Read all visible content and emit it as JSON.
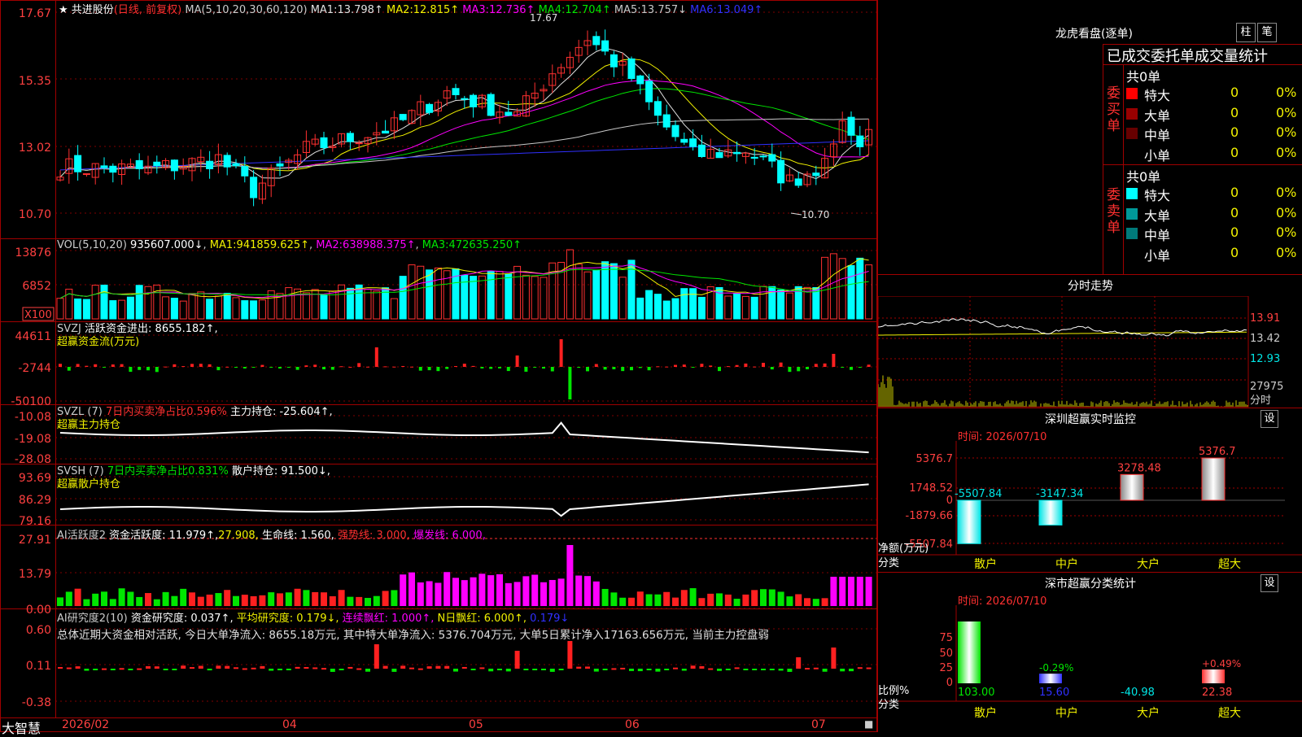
{
  "stock": {
    "name": "共进股份",
    "mode": "(日线, 前复权)",
    "ma_header": "MA(5,10,20,30,60,120)",
    "ma": [
      {
        "label": "MA1:",
        "value": "13.798↑",
        "color": "#e0e0e0"
      },
      {
        "label": "MA2:",
        "value": "12.815↑",
        "color": "#f2f200"
      },
      {
        "label": "MA3:",
        "value": "12.736↑",
        "color": "#ff00ff"
      },
      {
        "label": "MA4:",
        "value": "12.704↑",
        "color": "#00e600"
      },
      {
        "label": "MA5:",
        "value": "13.757↓",
        "color": "#c8c8c8"
      },
      {
        "label": "MA6:",
        "value": "13.049↑",
        "color": "#3030ff"
      }
    ],
    "y_ticks": [
      "17.67",
      "15.35",
      "13.02",
      "10.70"
    ],
    "high_label": "17.67",
    "low_label": "10.70"
  },
  "vol": {
    "header": "VOL(5,10,20)",
    "value": "935607.000↓",
    "ma": [
      {
        "label": "MA1:",
        "value": "941859.625↑",
        "color": "#f2f200"
      },
      {
        "label": "MA2:",
        "value": "638988.375↑",
        "color": "#ff00ff"
      },
      {
        "label": "MA3:",
        "value": "472635.250↑",
        "color": "#00e600"
      }
    ],
    "y_ticks": [
      "13876",
      "6852",
      "X100"
    ]
  },
  "svzj": {
    "header": "SVZJ",
    "text": "活跃资金进出: 8655.182↑,",
    "subtitle": "超赢资金流(万元)",
    "y_ticks": [
      "44611",
      "-2744",
      "-50100"
    ]
  },
  "svzl": {
    "header": "SVZL (7)",
    "ratio": "7日内买卖净占比0.596%",
    "hold": "主力持仓: -25.604↑,",
    "subtitle": "超赢主力持仓",
    "y_ticks": [
      "-10.08",
      "-19.08",
      "-28.08"
    ]
  },
  "svsh": {
    "header": "SVSH (7)",
    "ratio": "7日内买卖净占比0.831%",
    "hold": "散户持仓: 91.500↓,",
    "subtitle": "超赢散户持仓",
    "y_ticks": [
      "93.69",
      "86.29",
      "79.16"
    ]
  },
  "ai_active": {
    "header": "AI活跃度2",
    "a": "资金活跃度: 11.979↑,",
    "b": "27.908,",
    "c": "生命线: 1.560,",
    "d": "强势线: 3.000,",
    "e": "爆发线: 6.000,",
    "y_ticks": [
      "27.91",
      "13.79",
      "0.00"
    ]
  },
  "ai_research": {
    "header": "AI研究度2(10)",
    "a": "资金研究度: 0.037↑,",
    "b": "平均研究度: 0.179↓,",
    "c": "连续飘红: 1.000↑,",
    "d": "N日飘红: 6.000↑,",
    "e": "0.179↓",
    "summary": "总体近期大资金相对活跃, 今日大单净流入: 8655.18万元, 其中特大单净流入: 5376.704万元, 大单5日累计净入17163.656万元, 当前主力控盘弱",
    "y_ticks": [
      "0.60",
      "0.11",
      "-0.38"
    ]
  },
  "xaxis": {
    "labels": [
      "2026/02",
      "04",
      "05",
      "06",
      "07"
    ]
  },
  "brand": "大智慧",
  "longhu": {
    "title": "龙虎看盘(逐单)",
    "btn1": "柱",
    "btn2": "笔",
    "stat_title": "已成交委托单成交量统计",
    "buy_label": "委买单",
    "sell_label": "委卖单",
    "total": "共0单",
    "buy_rows": [
      {
        "name": "特大",
        "count": "0",
        "pct": "0%",
        "color": "#ff0000"
      },
      {
        "name": "大单",
        "count": "0",
        "pct": "0%",
        "color": "#990000"
      },
      {
        "name": "中单",
        "count": "0",
        "pct": "0%",
        "color": "#660000"
      },
      {
        "name": "小单",
        "count": "0",
        "pct": "0%",
        "color": ""
      }
    ],
    "sell_rows": [
      {
        "name": "特大",
        "count": "0",
        "pct": "0%",
        "color": "#00ffff"
      },
      {
        "name": "大单",
        "count": "0",
        "pct": "0%",
        "color": "#009999"
      },
      {
        "name": "中单",
        "count": "0",
        "pct": "0%",
        "color": "#007a7a"
      },
      {
        "name": "小单",
        "count": "0",
        "pct": "0%",
        "color": ""
      }
    ]
  },
  "fenshi": {
    "title": "分时走势",
    "y_ticks": [
      "13.91",
      "13.42",
      "12.93",
      "27975"
    ],
    "vol_label": "分时"
  },
  "sz_monitor": {
    "title": "深圳超赢实时监控",
    "btn": "设",
    "time": "时间: 2026/07/10",
    "y_ticks": [
      "5376.7",
      "1748.52",
      "0",
      "-1879.66",
      "-5507.84"
    ],
    "unit_label": "净额(万元)",
    "cat_label": "分类",
    "categories": [
      "散户",
      "中户",
      "大户",
      "超大"
    ],
    "values": [
      -5507.84,
      -3147.34,
      3278.48,
      5376.7
    ],
    "value_labels": [
      "-5507.84",
      "-3147.34",
      "3278.48",
      "5376.7"
    ]
  },
  "sz_class": {
    "title": "深市超赢分类统计",
    "btn": "设",
    "time": "时间: 2026/07/10",
    "y_ticks": [
      "75",
      "50",
      "25",
      "0"
    ],
    "unit_label": "比例%",
    "cat_label": "分类",
    "categories": [
      "散户",
      "中户",
      "大户",
      "超大"
    ],
    "values": [
      "103.00",
      "15.60",
      "-40.98",
      "22.38"
    ],
    "bar_labels": [
      "",
      "-0.29%",
      "",
      "+0.49%"
    ]
  }
}
